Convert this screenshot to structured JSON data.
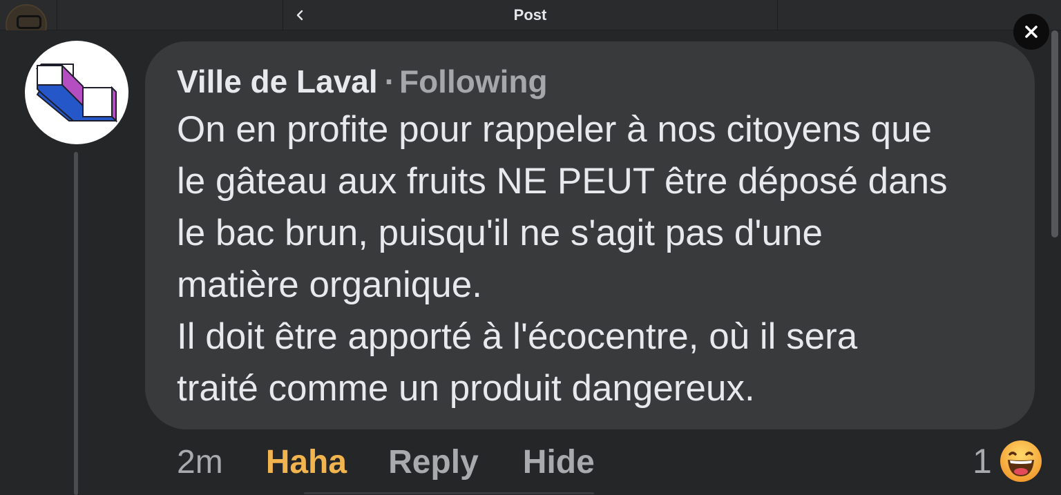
{
  "header": {
    "title": "Post",
    "back_icon": "chevron-left-icon"
  },
  "close": {
    "icon": "close-icon"
  },
  "comment": {
    "author": "Ville de Laval",
    "separator": "·",
    "follow_status": "Following",
    "body_lines": [
      "On en profite pour rappeler à nos citoyens que",
      "le gâteau aux fruits NE PEUT être déposé dans",
      "le bac brun, puisqu'il ne s'agit pas d'une",
      "matière organique.",
      "Il doit être apporté à l'écocentre, où il sera",
      "traité comme un produit dangereux."
    ],
    "timestamp": "2m",
    "reaction_label": "Haha",
    "reply_label": "Reply",
    "hide_label": "Hide",
    "reaction_count": "1",
    "reaction_icon": "laughing-emoji-icon"
  },
  "colors": {
    "background": "#18191b",
    "bubble": "#393a3c",
    "text": "#e8e9ec",
    "muted": "#a8aaae",
    "haha_accent": "#f2b44e"
  }
}
